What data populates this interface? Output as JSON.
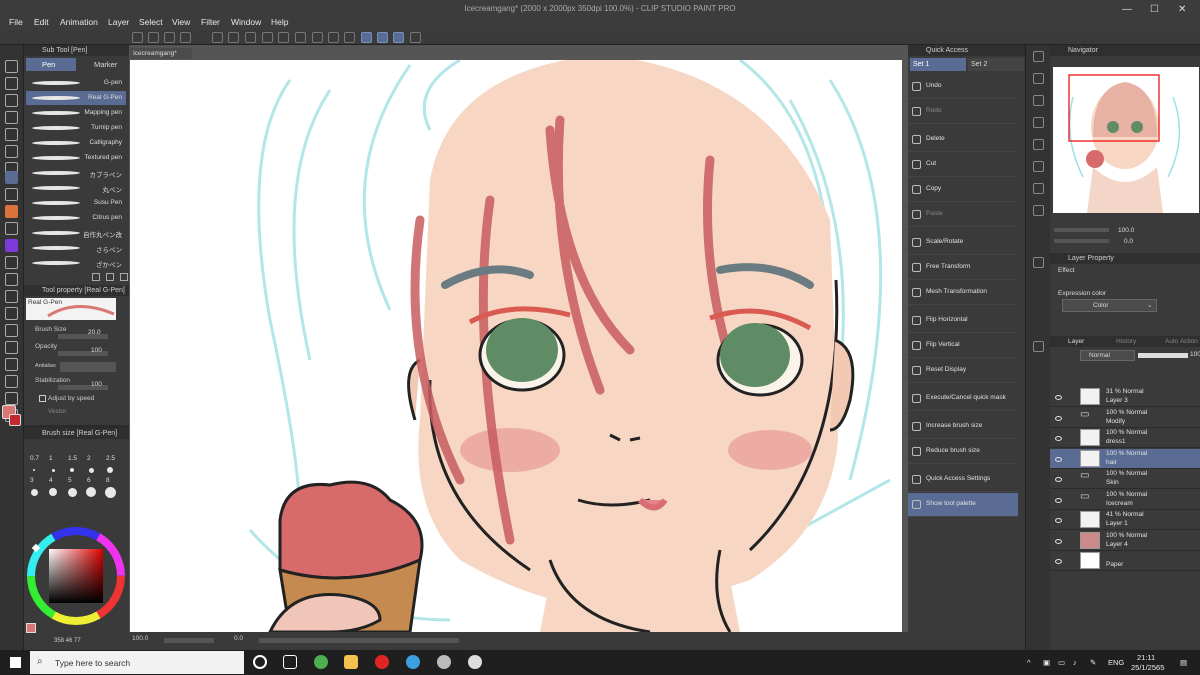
{
  "window": {
    "title": "Icecreamgang* (2000 x 2000px 350dpi 100.0%)  - CLIP STUDIO PAINT PRO"
  },
  "menu": [
    "File",
    "Edit",
    "Animation",
    "Layer",
    "Select",
    "View",
    "Filter",
    "Window",
    "Help"
  ],
  "sub_tool": {
    "panel_title": "Sub Tool [Pen]",
    "tabs": [
      "Pen",
      "Marker"
    ],
    "items": [
      "G-pen",
      "Real G-Pen",
      "Mapping pen",
      "Turnip pen",
      "Calligraphy",
      "Textured pen",
      "カブラペン",
      "丸ペン",
      "Susu Pen",
      "Citrus pen",
      "自作丸ペン改",
      "さらペン",
      "ざかペン"
    ],
    "selected_index": 1
  },
  "tool_property": {
    "panel_title": "Tool property [Real G-Pen]",
    "preview_label": "Real G-Pen",
    "brush_size_label": "Brush Size",
    "brush_size_value": "20.0",
    "opacity_label": "Opacity",
    "opacity_value": "100",
    "antialias_label": "Antialias",
    "stabilization_label": "Stabilization",
    "stabilization_value": "100",
    "adjust_label": "Adjust by speed",
    "vector_label": "Vector"
  },
  "brush_size": {
    "panel_title": "Brush size [Real G-Pen]",
    "values": [
      "0.7",
      "1",
      "1.5",
      "2",
      "2.5",
      "3",
      "4",
      "5",
      "6",
      "8"
    ]
  },
  "document": {
    "tab_label": "Icecreamgang*",
    "zoom": "100.0",
    "rotation": "0.0"
  },
  "quick_access": {
    "panel_title": "Quick Access",
    "sets": [
      "Set 1",
      "Set 2"
    ],
    "items": [
      {
        "label": "Undo",
        "disabled": false
      },
      {
        "label": "Redo",
        "disabled": true
      },
      {
        "label": "Delete",
        "disabled": false
      },
      {
        "label": "Cut",
        "disabled": false
      },
      {
        "label": "Copy",
        "disabled": false
      },
      {
        "label": "Paste",
        "disabled": true
      },
      {
        "label": "Scale/Rotate",
        "disabled": false
      },
      {
        "label": "Free Transform",
        "disabled": false
      },
      {
        "label": "Mesh Transformation",
        "disabled": false
      },
      {
        "label": "Flip Horizontal",
        "disabled": false
      },
      {
        "label": "Flip Vertical",
        "disabled": false
      },
      {
        "label": "Reset Display",
        "disabled": false
      },
      {
        "label": "Execute/Cancel quick mask",
        "disabled": false
      },
      {
        "label": "Increase brush size",
        "disabled": false
      },
      {
        "label": "Reduce brush size",
        "disabled": false
      },
      {
        "label": "Quick Access Settings",
        "disabled": false
      },
      {
        "label": "Show tool palette",
        "disabled": false
      }
    ]
  },
  "navigator": {
    "panel_title": "Navigator",
    "zoom": "100.0",
    "rotation": "0.0"
  },
  "layer_property": {
    "panel_title": "Layer Property",
    "effect_label": "Effect",
    "expression_label": "Expression color",
    "expression_value": "Color"
  },
  "layers": {
    "tabs": [
      "Layer",
      "History",
      "Auto Action"
    ],
    "blend_mode": "Normal",
    "opacity": "100",
    "rows": [
      {
        "line1": "31 % Normal",
        "line2": "Layer 3",
        "type": "raster"
      },
      {
        "line1": "100 % Normal",
        "line2": "Modify",
        "type": "folder"
      },
      {
        "line1": "100 % Normal",
        "line2": "dress1",
        "type": "raster"
      },
      {
        "line1": "100 % Normal",
        "line2": "hair",
        "type": "raster",
        "selected": true
      },
      {
        "line1": "100 % Normal",
        "line2": "Skin",
        "type": "folder"
      },
      {
        "line1": "100 % Normal",
        "line2": "Icecream",
        "type": "folder"
      },
      {
        "line1": "41 % Normal",
        "line2": "Layer 1",
        "type": "raster"
      },
      {
        "line1": "100 % Normal",
        "line2": "Layer 4",
        "type": "fill"
      },
      {
        "line1": "",
        "line2": "Paper",
        "type": "paper"
      }
    ]
  },
  "taskbar": {
    "search_placeholder": "Type here to search",
    "language": "ENG",
    "time": "21:11",
    "date": "25/1/2565"
  },
  "colors": {
    "accent": "#5a6b94",
    "main_color": "#d87874",
    "skin": "#f7d7c4",
    "sketch": "#9fe0e2",
    "eye": "#5f8c64",
    "hair_red": "#c85c60",
    "icecream": "#d76b6b",
    "cone": "#c58a4f"
  }
}
